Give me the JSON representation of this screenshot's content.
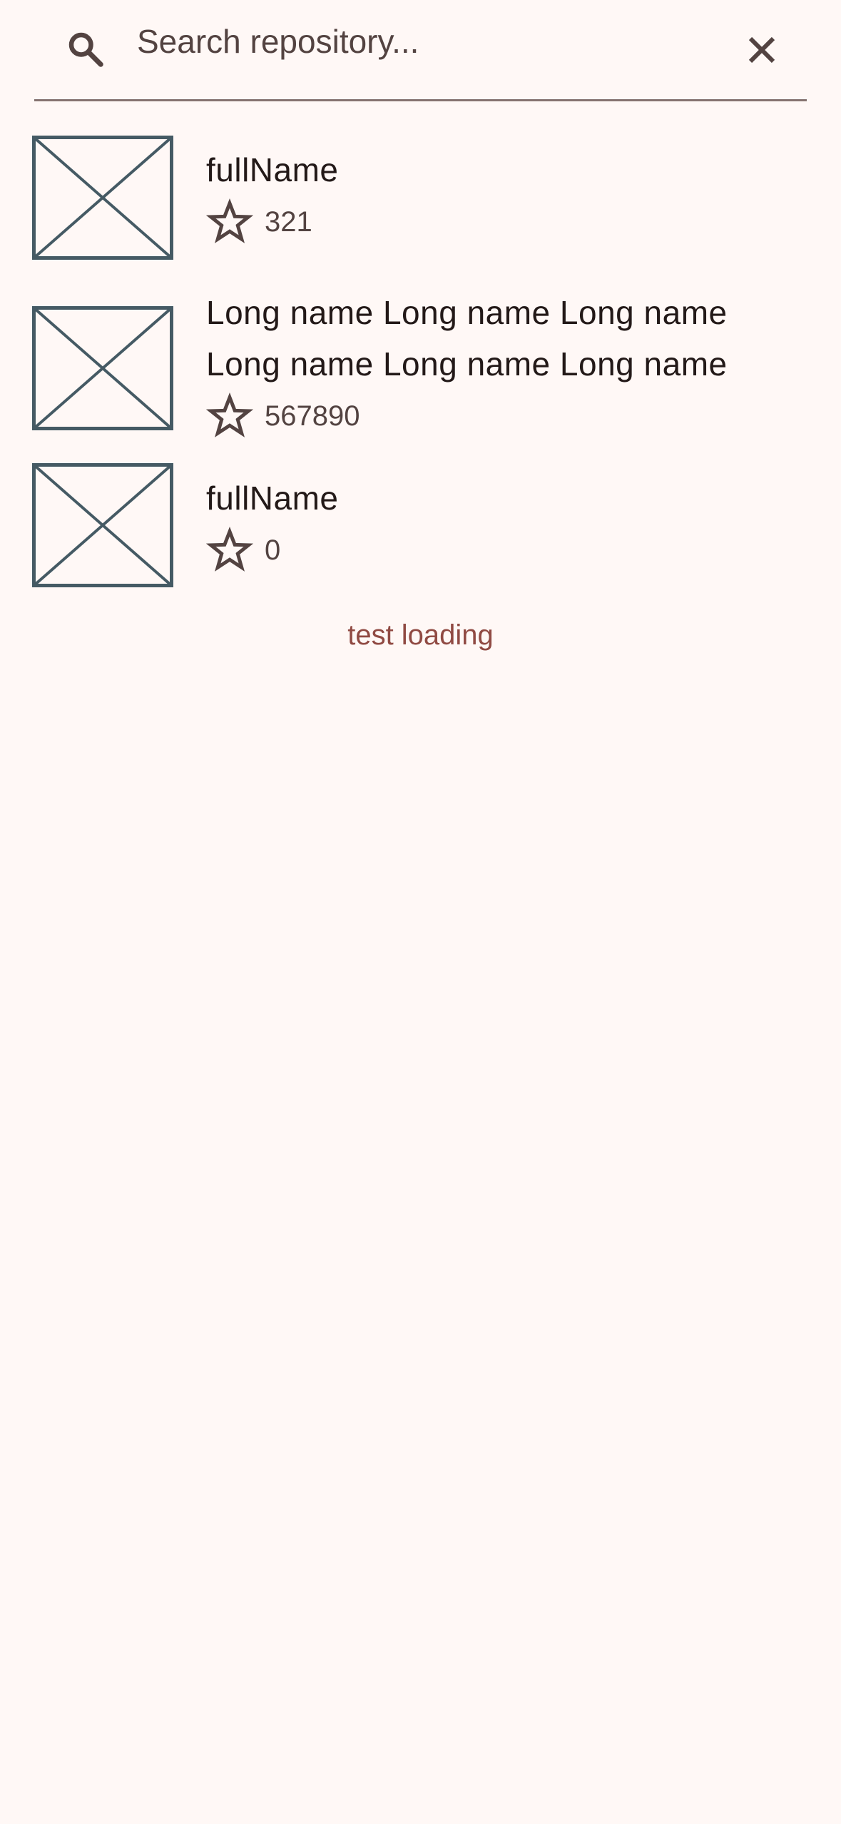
{
  "search": {
    "placeholder": "Search repository...",
    "value": ""
  },
  "colors": {
    "background": "#fff8f6",
    "on_surface": "#231918",
    "on_surface_variant": "#534341",
    "outline": "#857370",
    "primary": "#904a43",
    "placeholder_image": "#455a64"
  },
  "icons": {
    "search": "search-icon",
    "clear": "close-icon",
    "star": "star-outline-icon",
    "avatar": "broken-image-placeholder-icon"
  },
  "repositories": [
    {
      "full_name": "fullName",
      "stars": "321"
    },
    {
      "full_name": "Long name Long name Long name Long name Long name Long name",
      "stars": "567890"
    },
    {
      "full_name": "fullName",
      "stars": "0"
    }
  ],
  "status": {
    "loading_text": "test loading"
  }
}
